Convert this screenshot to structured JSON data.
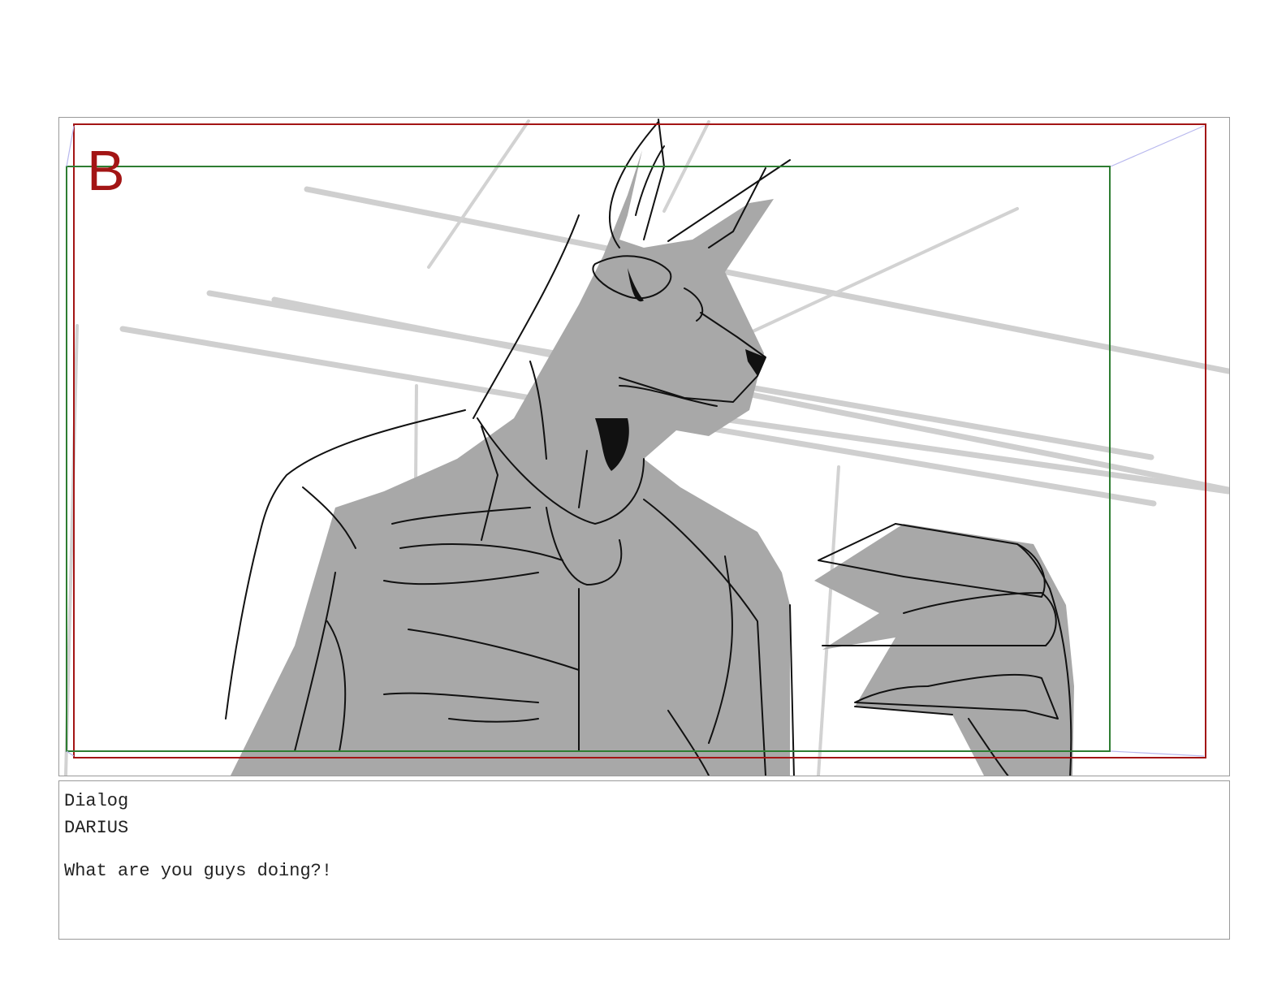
{
  "panel": {
    "label": "B",
    "safe_area_color": "#a31515",
    "action_area_color": "#2e7d32",
    "sketch_fill": "#a8a8a8",
    "background_lines": "#cfcfcf"
  },
  "dialog": {
    "heading": "Dialog",
    "character": "DARIUS",
    "line": "What are you guys doing?!"
  }
}
